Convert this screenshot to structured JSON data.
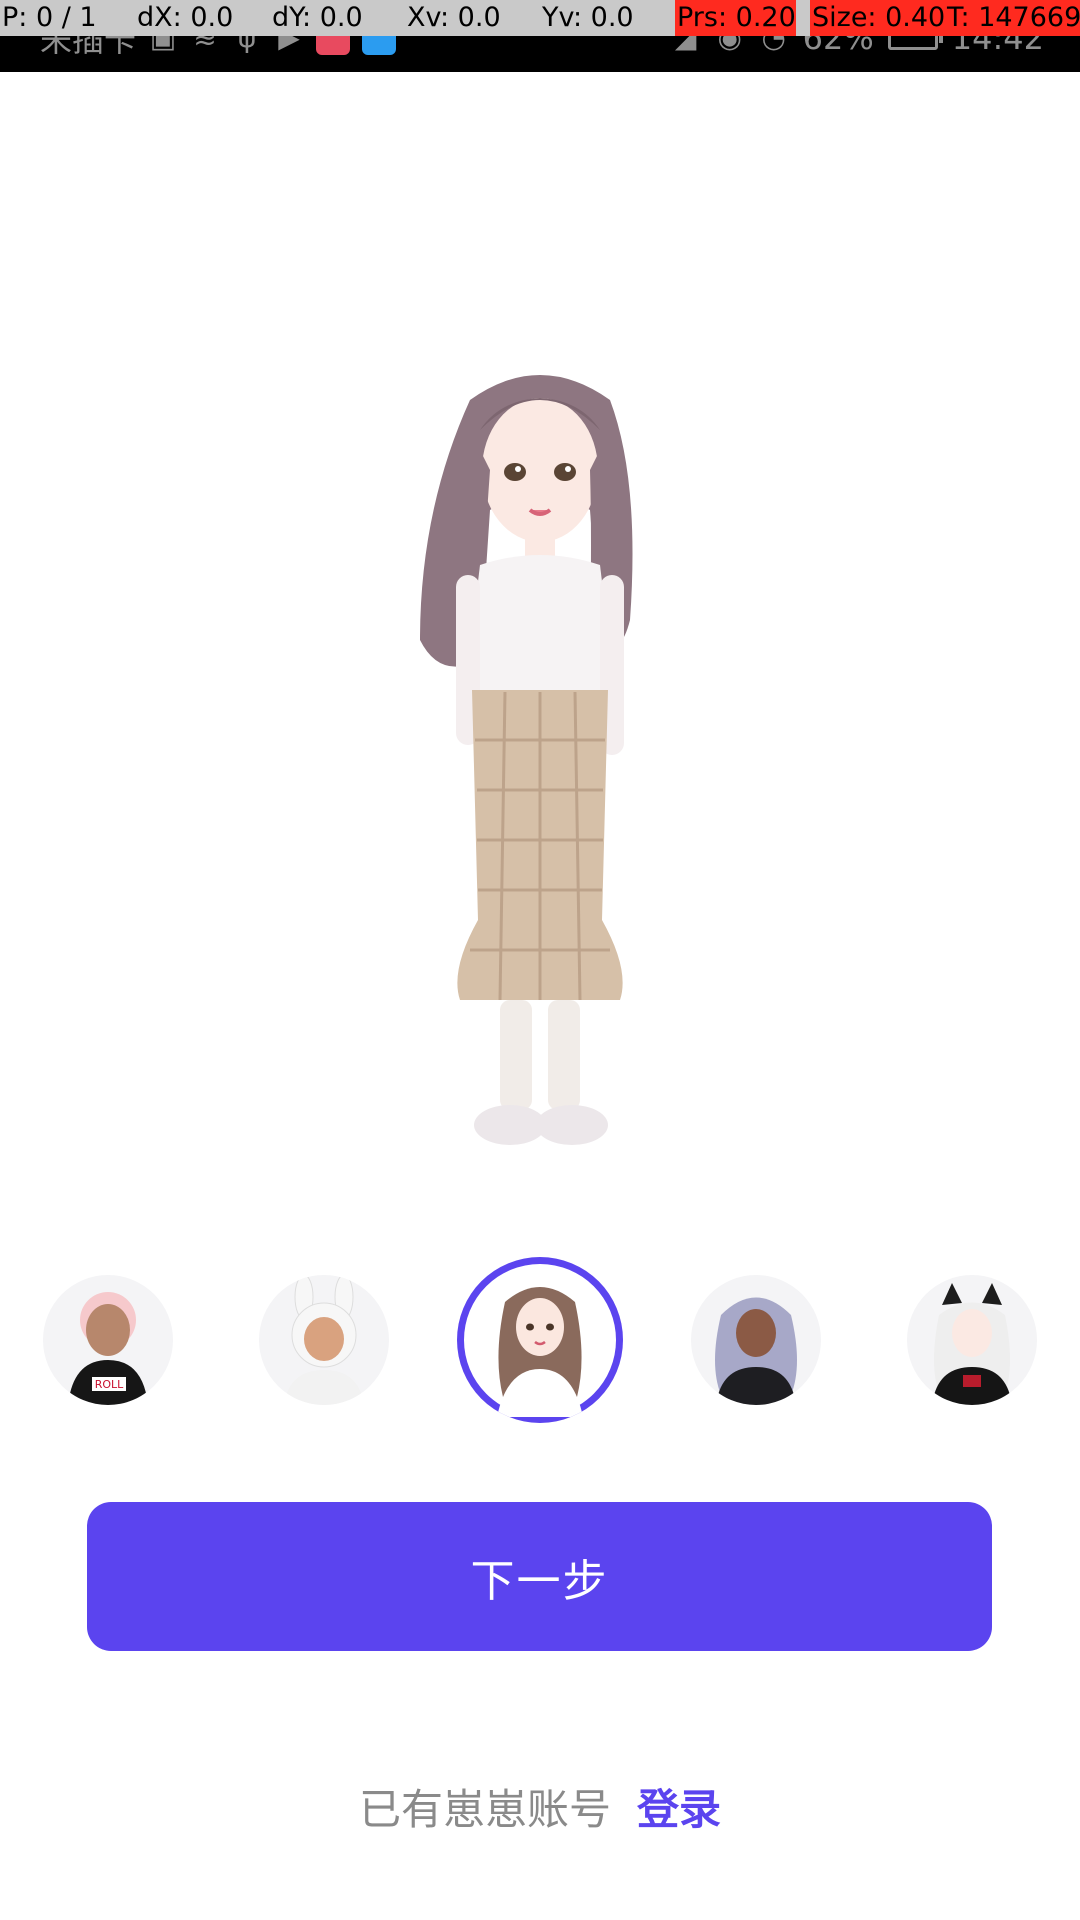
{
  "debug_overlay": {
    "p": "P: 0 / 1",
    "dx": "dX: 0.0",
    "dy": "dY: 0.0",
    "xv": "Xv: 0.0",
    "yv": "Yv: 0.0",
    "prs": "Prs: 0.20",
    "size": "Size: 0.40",
    "t": "T: 147669"
  },
  "status_bar": {
    "carrier": "未插卡",
    "battery_percent": "62%",
    "time": "14:42"
  },
  "avatar_picker": {
    "selected_index": 2,
    "items": [
      {
        "name": "avatar-pink-hair-boy",
        "shirt_text": "ROLL"
      },
      {
        "name": "avatar-bunny-hood"
      },
      {
        "name": "avatar-long-hair-girl"
      },
      {
        "name": "avatar-silver-curly-hair"
      },
      {
        "name": "avatar-cat-ears-girl"
      }
    ]
  },
  "main": {
    "next_label": "下一步",
    "login_prompt": "已有崽崽账号",
    "login_link": "登录"
  },
  "colors": {
    "accent": "#5b44ef",
    "prompt_text": "#8a8a8a"
  }
}
